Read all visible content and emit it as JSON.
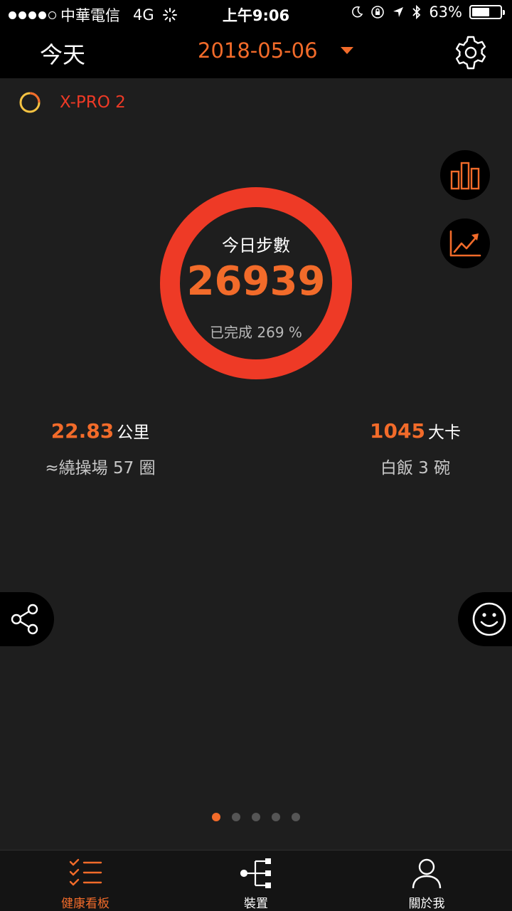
{
  "status_bar": {
    "carrier": "中華電信",
    "network": "4G",
    "time": "上午9:06",
    "battery": "63%",
    "battery_level": 0.63
  },
  "nav": {
    "title": "今天",
    "date": "2018-05-06"
  },
  "device": {
    "name": "X-PRO 2"
  },
  "ring": {
    "label": "今日步數",
    "steps": "26939",
    "percent": "已完成 269 %",
    "progress": 1.0
  },
  "stats": {
    "distance": {
      "value": "22.83",
      "unit": "公里",
      "sub": "≈繞操場 57 圈"
    },
    "calories": {
      "value": "1045",
      "unit": "大卡",
      "sub": "白飯 3 碗"
    }
  },
  "pagination": {
    "pages": 5,
    "current": 1
  },
  "tabs": [
    {
      "label": "健康看板"
    },
    {
      "label": "裝置"
    },
    {
      "label": "關於我"
    }
  ],
  "colors": {
    "accent": "#f26b2a",
    "ring": "#ee3a26",
    "background": "#1e1e1e"
  },
  "icons": {
    "settings": "gear-icon",
    "bar_chart": "bar-chart-icon",
    "trend_chart": "trend-chart-icon",
    "share": "share-icon",
    "smiley": "smiley-icon",
    "dashboard": "checklist-icon",
    "device": "device-tree-icon",
    "profile": "person-icon"
  }
}
